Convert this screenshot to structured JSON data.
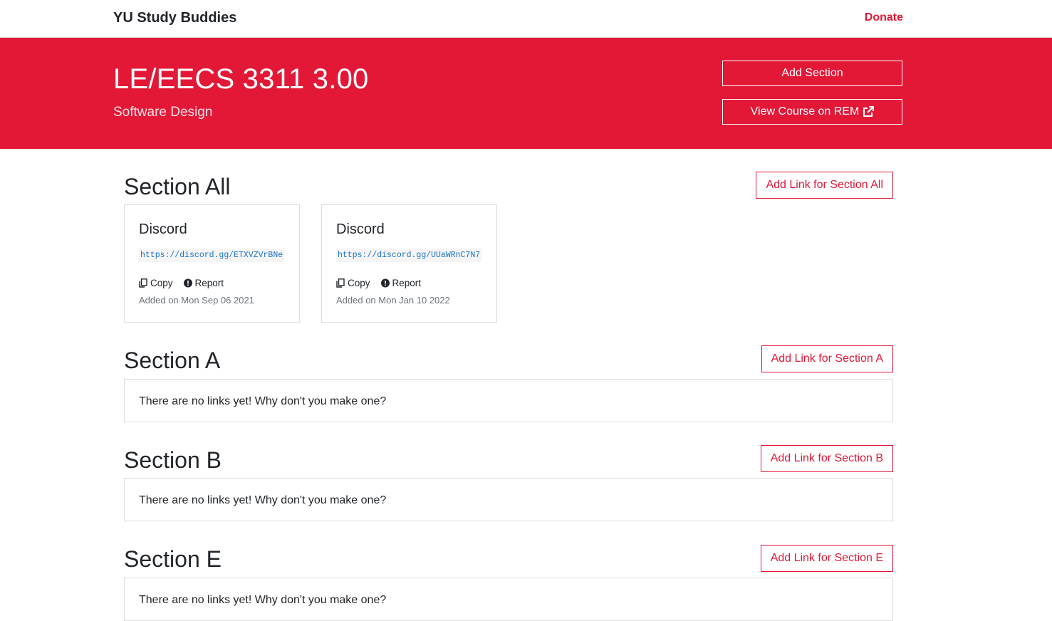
{
  "navbar": {
    "brand": "YU Study Buddies",
    "donate": "Donate"
  },
  "hero": {
    "course_code": "LE/EECS 3311 3.00",
    "course_name": "Software Design",
    "add_section_label": "Add Section",
    "view_rem_label": "View Course on REM",
    "view_rem_icon": "external-link-icon"
  },
  "colors": {
    "brand_red": "#e31837",
    "link_blue": "#1a73c8"
  },
  "sections": [
    {
      "title": "Section All",
      "add_label": "Add Link for Section All",
      "links": [
        {
          "platform": "Discord",
          "url": "https://discord.gg/ETXVZVrBNe",
          "copy": "Copy",
          "report": "Report",
          "added": "Added on Mon Sep 06 2021"
        },
        {
          "platform": "Discord",
          "url": "https://discord.gg/UUaWRnC7N7",
          "copy": "Copy",
          "report": "Report",
          "added": "Added on Mon Jan 10 2022"
        }
      ]
    },
    {
      "title": "Section A",
      "add_label": "Add Link for Section A",
      "empty": "There are no links yet! Why don't you make one?"
    },
    {
      "title": "Section B",
      "add_label": "Add Link for Section B",
      "empty": "There are no links yet! Why don't you make one?"
    },
    {
      "title": "Section E",
      "add_label": "Add Link for Section E",
      "empty": "There are no links yet! Why don't you make one?"
    }
  ]
}
